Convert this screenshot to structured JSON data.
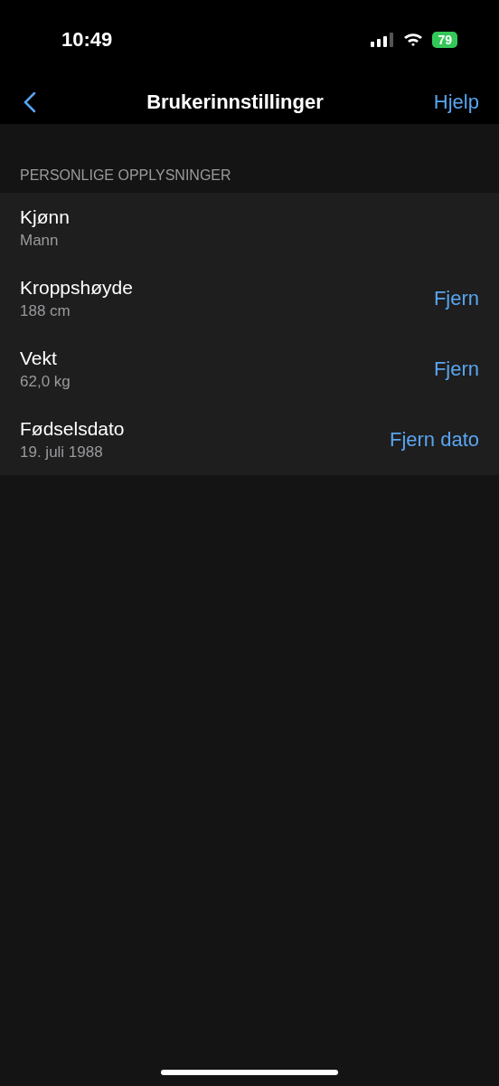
{
  "status_bar": {
    "time": "10:49",
    "battery": "79"
  },
  "nav": {
    "title": "Brukerinnstillinger",
    "action": "Hjelp"
  },
  "section": {
    "header": "PERSONLIGE OPPLYSNINGER",
    "rows": [
      {
        "label": "Kjønn",
        "value": "Mann"
      },
      {
        "label": "Kroppshøyde",
        "value": "188 cm",
        "action": "Fjern"
      },
      {
        "label": "Vekt",
        "value": "62,0 kg",
        "action": "Fjern"
      },
      {
        "label": "Fødselsdato",
        "value": "19. juli 1988",
        "action": "Fjern dato"
      }
    ]
  }
}
